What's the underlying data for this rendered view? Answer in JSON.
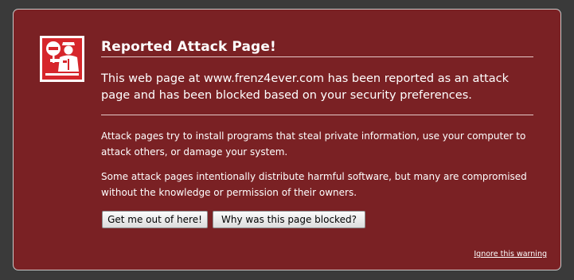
{
  "warning": {
    "title": "Reported Attack Page!",
    "intro": "This web page at www.frenz4ever.com has been reported as an attack page and has been blocked based on your security preferences.",
    "paragraphs": [
      "Attack pages try to install programs that steal private information, use your computer to attack others, or damage your system.",
      "Some attack pages intentionally distribute harmful software, but many are compromised without the knowledge or permission of their owners."
    ],
    "buttons": {
      "get_out": "Get me out of here!",
      "why_blocked": "Why was this page blocked?"
    },
    "ignore_link": "Ignore this warning",
    "icon": "security-officer-stop-icon"
  },
  "colors": {
    "background": "#7a2124",
    "icon_red": "#d6262b",
    "text": "#ffffff"
  }
}
